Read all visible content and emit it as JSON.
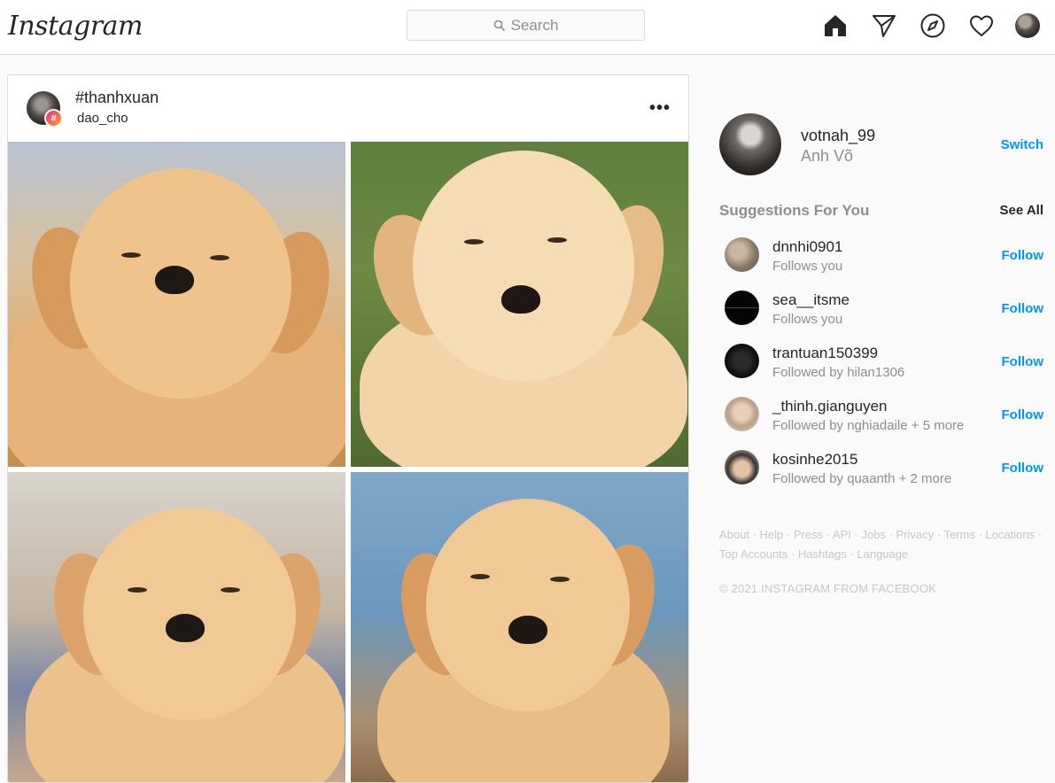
{
  "nav": {
    "logo": "Instagram",
    "search_placeholder": "Search",
    "icons": [
      "home-icon",
      "direct-icon",
      "explore-icon",
      "activity-heart-icon",
      "profile-avatar"
    ]
  },
  "post": {
    "title": "#thanhxuan",
    "subtitle": "dao_cho",
    "more_label": "•••",
    "badge": "#"
  },
  "sidebar": {
    "username": "votnah_99",
    "full_name": "Anh Võ",
    "switch_label": "Switch",
    "suggestions_title": "Suggestions For You",
    "see_all_label": "See All",
    "suggestions": [
      {
        "user": "dnnhi0901",
        "note": "Follows you",
        "action": "Follow"
      },
      {
        "user": "sea__itsme",
        "note": "Follows you",
        "action": "Follow"
      },
      {
        "user": "trantuan150399",
        "note": "Followed by hilan1306",
        "action": "Follow"
      },
      {
        "user": "_thinh.gianguyen",
        "note": "Followed by nghiadaile + 5 more",
        "action": "Follow"
      },
      {
        "user": "kosinhe2015",
        "note": "Followed by quaanth + 2 more",
        "action": "Follow"
      }
    ],
    "footer_links": [
      "About",
      "Help",
      "Press",
      "API",
      "Jobs",
      "Privacy",
      "Terms",
      "Locations",
      "Top Accounts",
      "Hashtags",
      "Language"
    ],
    "copyright": "© 2021 INSTAGRAM FROM FACEBOOK"
  },
  "colors": {
    "link_blue": "#0095f6",
    "muted": "#8e8e8e",
    "border": "#dbdbdb",
    "background": "#fafafa"
  }
}
